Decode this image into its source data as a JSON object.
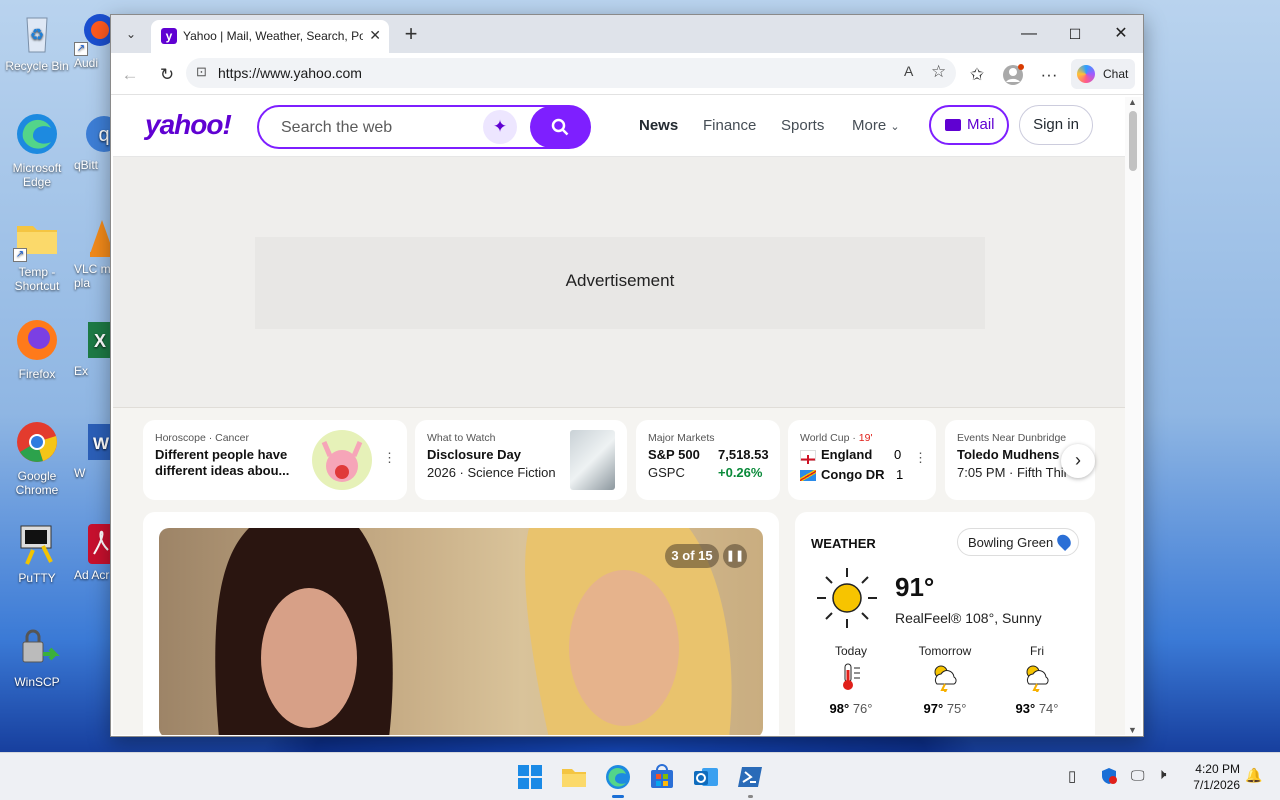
{
  "desktop": {
    "icons": [
      {
        "label": "Recycle Bin",
        "icon": "recycle-bin-icon"
      },
      {
        "label": "Audi",
        "icon": "audio-app-icon"
      },
      {
        "label": "Microsoft Edge",
        "icon": "edge-icon"
      },
      {
        "label": "qBitt",
        "icon": "qbittorrent-icon"
      },
      {
        "label": "Temp - Shortcut",
        "icon": "folder-icon"
      },
      {
        "label": "VLC m pla",
        "icon": "vlc-icon"
      },
      {
        "label": "Firefox",
        "icon": "firefox-icon"
      },
      {
        "label": "Ex",
        "icon": "excel-icon"
      },
      {
        "label": "Google Chrome",
        "icon": "chrome-icon"
      },
      {
        "label": "W",
        "icon": "word-icon"
      },
      {
        "label": "PuTTY",
        "icon": "putty-icon"
      },
      {
        "label": "Ad Acr",
        "icon": "acrobat-icon"
      },
      {
        "label": "WinSCP",
        "icon": "winscp-icon"
      }
    ]
  },
  "browser": {
    "tab_title": "Yahoo | Mail, Weather, Search, Poli",
    "url": "https://www.yahoo.com",
    "chat_label": "Chat"
  },
  "yahoo": {
    "logo": "yahoo!",
    "search_placeholder": "Search the web",
    "nav": [
      "News",
      "Finance",
      "Sports",
      "More"
    ],
    "mail_label": "Mail",
    "signin_label": "Sign in",
    "ad_label": "Advertisement",
    "cards": {
      "horoscope": {
        "category": "Horoscope",
        "sub": "Cancer",
        "title": "Different people have different ideas abou..."
      },
      "watch": {
        "category": "What to Watch",
        "title": "Disclosure Day",
        "sub": "2026 · Science Fiction"
      },
      "markets": {
        "category": "Major Markets",
        "name": "S&P 500",
        "value": "7,518.53",
        "ticker": "GSPC",
        "change": "+0.26%"
      },
      "worldcup": {
        "category": "World Cup",
        "minute": "19'",
        "team1": "England",
        "score1": "0",
        "team2": "Congo DR",
        "score2": "1"
      },
      "events": {
        "category": "Events Near Dunbridge",
        "title": "Toledo Mudhens",
        "sub": "7:05 PM · Fifth Thir"
      }
    },
    "slideshow": {
      "counter": "3 of 15"
    },
    "weather": {
      "heading": "WEATHER",
      "location": "Bowling Green",
      "temp": "91°",
      "realfeel": "RealFeel® 108°, Sunny",
      "forecast": [
        {
          "day": "Today",
          "hi": "98°",
          "lo": "76°",
          "icon": "thermometer-icon"
        },
        {
          "day": "Tomorrow",
          "hi": "97°",
          "lo": "75°",
          "icon": "thunderstorm-icon"
        },
        {
          "day": "Fri",
          "hi": "93°",
          "lo": "74°",
          "icon": "thunderstorm-icon"
        }
      ]
    }
  },
  "taskbar": {
    "time": "4:20 PM",
    "date": "7/1/2026"
  },
  "colors": {
    "yahoo_purple": "#7e1fff",
    "positive_green": "#0a8a3a"
  }
}
